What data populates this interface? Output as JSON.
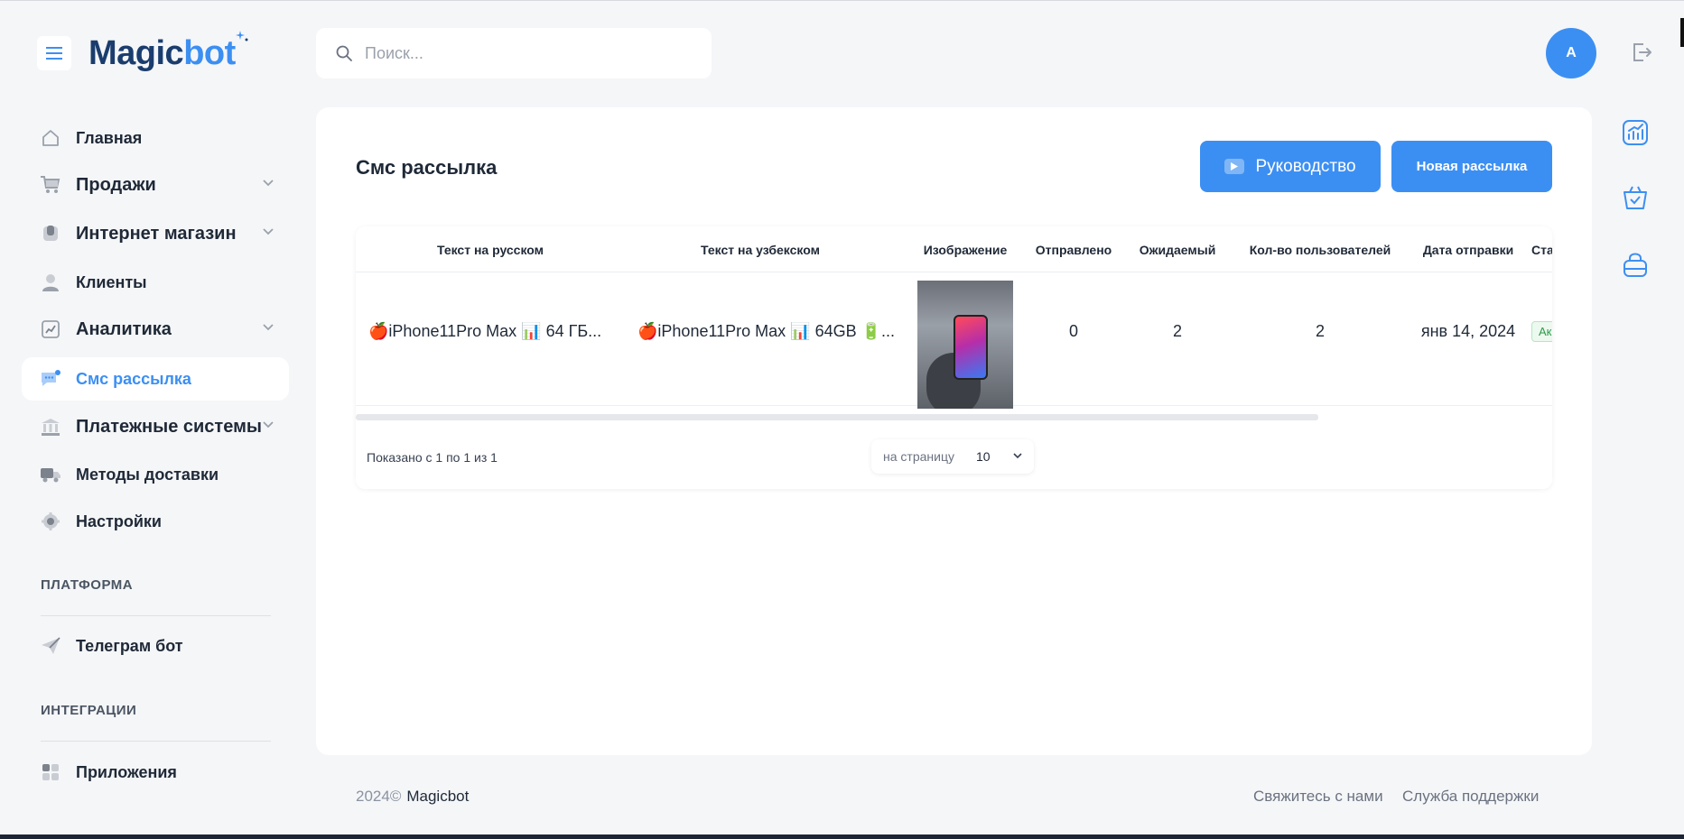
{
  "app": {
    "logo_part1": "Magic",
    "logo_part2": "bot"
  },
  "search": {
    "placeholder": "Поиск..."
  },
  "user": {
    "avatar_initial": "A"
  },
  "sidebar": {
    "items": [
      {
        "label": "Главная",
        "icon": "home-icon",
        "has_chevron": false
      },
      {
        "label": "Продажи",
        "icon": "cart-icon",
        "has_chevron": true
      },
      {
        "label": "Интернет магазин",
        "icon": "store-icon",
        "has_chevron": true
      },
      {
        "label": "Клиенты",
        "icon": "user-icon",
        "has_chevron": false
      },
      {
        "label": "Аналитика",
        "icon": "analytics-icon",
        "has_chevron": true
      },
      {
        "label": "Смс рассылка",
        "icon": "chat-icon",
        "has_chevron": false,
        "active": true
      },
      {
        "label": "Платежные системы",
        "icon": "bank-icon",
        "has_chevron": true
      },
      {
        "label": "Методы доставки",
        "icon": "truck-icon",
        "has_chevron": false
      },
      {
        "label": "Настройки",
        "icon": "gear-icon",
        "has_chevron": false
      }
    ],
    "section_platform": "ПЛАТФОРМА",
    "telegram_label": "Телеграм бот",
    "section_integrations": "ИНТЕГРАЦИИ",
    "apps_label": "Приложения"
  },
  "main": {
    "title": "Смс рассылка",
    "guide_button": "Руководство",
    "new_button": "Новая рассылка",
    "table": {
      "columns": [
        "Текст на русском",
        "Текст на узбекском",
        "Изображение",
        "Отправлено",
        "Ожидаемый",
        "Кол-во пользователей",
        "Дата отправки",
        "Ста"
      ],
      "rows": [
        {
          "text_ru": "🍎iPhone11Pro Max 📊 64 ГБ...",
          "text_uz": "🍎iPhone11Pro Max 📊 64GB 🔋...",
          "sent": "0",
          "expected": "2",
          "users": "2",
          "date": "янв 14, 2024",
          "status": "Ак"
        }
      ]
    },
    "pagination": {
      "summary": "Показано с 1 по 1 из 1",
      "per_page_label": "на страницу",
      "per_page_value": "10"
    }
  },
  "footer": {
    "year": "2024©",
    "brand": "Magicbot",
    "contact": "Свяжитесь с нами",
    "support": "Служба поддержки"
  },
  "colors": {
    "accent": "#3c8ff2",
    "logo_dark": "#1a3d6e",
    "background": "#f5f6f8"
  }
}
